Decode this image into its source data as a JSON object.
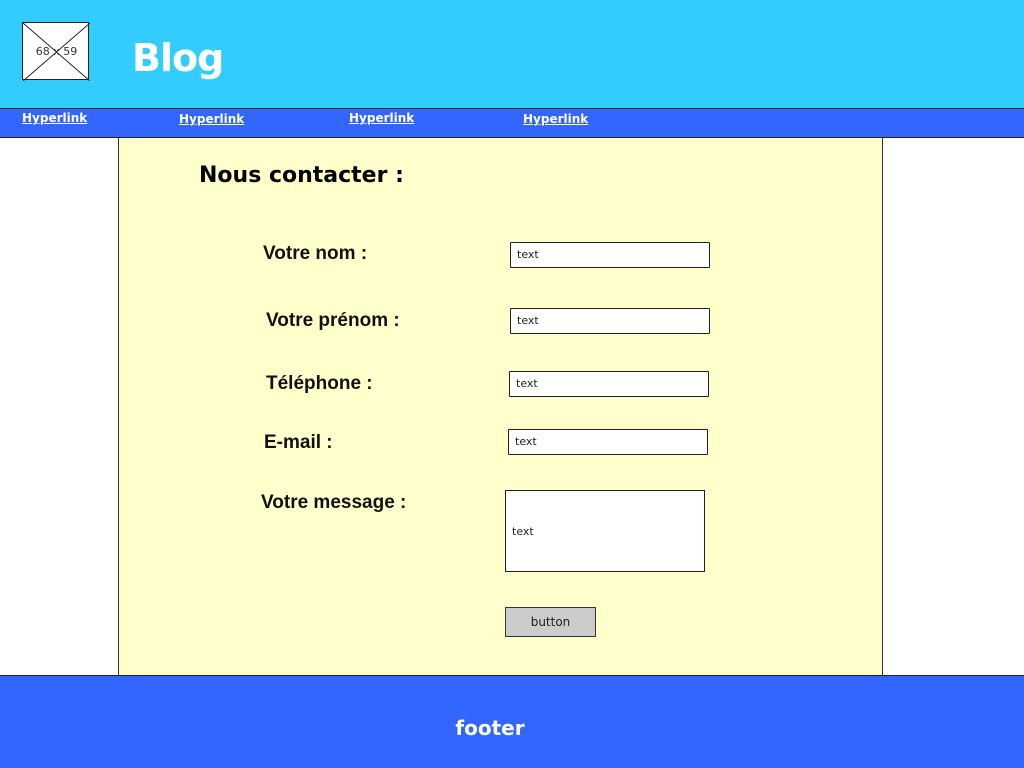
{
  "header": {
    "logo_placeholder_label": "68 x 59",
    "title": "Blog",
    "background_color": "#33ccff"
  },
  "nav": {
    "links": [
      "Hyperlink",
      "Hyperlink",
      "Hyperlink",
      "Hyperlink"
    ],
    "background_color": "#3366ff"
  },
  "content": {
    "heading": "Nous contacter :",
    "background_color": "#ffffcc",
    "fields": [
      {
        "label": "Votre nom :",
        "value": "text"
      },
      {
        "label": "Votre prénom :",
        "value": "text"
      },
      {
        "label": "Téléphone :",
        "value": "text"
      },
      {
        "label": "E-mail :",
        "value": "text"
      },
      {
        "label": "Votre message :",
        "value": "text"
      }
    ],
    "submit_label": "button"
  },
  "footer": {
    "text": "footer",
    "background_color": "#3366ff"
  }
}
